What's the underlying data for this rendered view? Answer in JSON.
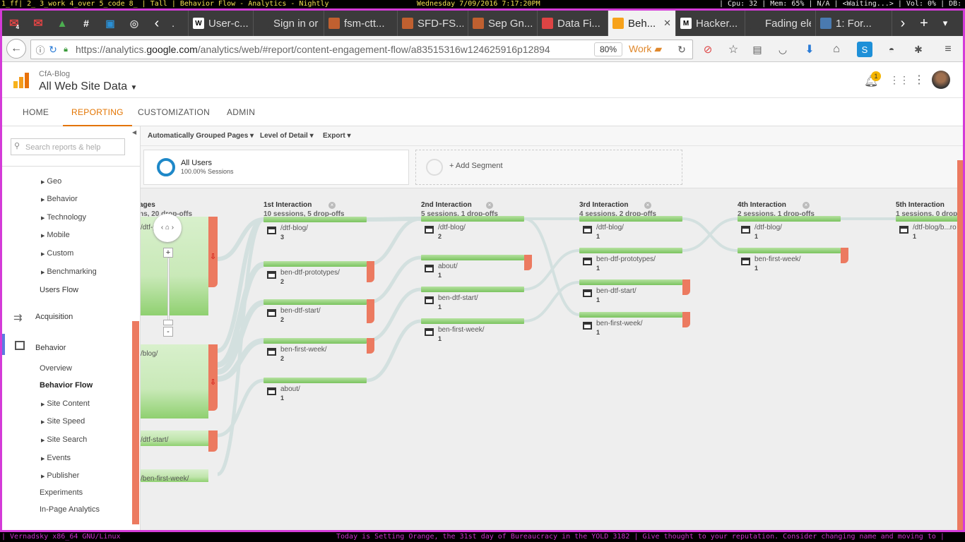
{
  "wm": {
    "top_left": "1_ff| 2_ 3_work 4_over 5_code 8_ | Tall | Behavior Flow - Analytics - Nightly",
    "top_center": "Wednesday  7/09/2016  7:17:20PM",
    "top_right": "| Cpu: 32 | Mem: 65% | N/A | <Waiting...> | Vol: 0% | DB:",
    "bottom_left": "| Vernadsky x86_64 GNU/Linux",
    "bottom_right": "Today is Setting Orange, the 31st day of Bureaucracy in the YOLD 3182  | Give thought to your reputation.  Consider changing name and moving to |"
  },
  "tabs": [
    {
      "label": "User-c...",
      "icon": "W",
      "color": "#ffffff"
    },
    {
      "label": "Sign in or ...",
      "icon": "",
      "color": "#3b3b3b"
    },
    {
      "label": "fsm-ctt...",
      "icon": "",
      "color": "#c06030"
    },
    {
      "label": "SFD-FS...",
      "icon": "",
      "color": "#c06030"
    },
    {
      "label": "Sep Gn...",
      "icon": "",
      "color": "#c06030"
    },
    {
      "label": "Data Fi...",
      "icon": "",
      "color": "#d44"
    },
    {
      "label": "Beh...",
      "icon": "",
      "color": "#f7a21b"
    },
    {
      "label": "Hacker...",
      "icon": "M",
      "color": "#ffffff"
    },
    {
      "label": "Fading ele...",
      "icon": "",
      "color": "#3b3b3b"
    },
    {
      "label": "1: For...",
      "icon": "",
      "color": "#4a7ab0"
    }
  ],
  "pinned_badge": "4",
  "nav": {
    "url_prefix": "https://analytics.",
    "url_domain": "google.com",
    "url_path": "/analytics/web/#report/content-engagement-flow/a83515316w124625916p12894",
    "zoom": "80%",
    "container": "Work"
  },
  "ga": {
    "account": "CfA-Blog",
    "property": "All Web Site Data",
    "notif_count": "1",
    "nav_items": [
      "HOME",
      "REPORTING",
      "CUSTOMIZATION",
      "ADMIN"
    ]
  },
  "sidebar": {
    "search_placeholder": "Search reports & help",
    "audience_items": [
      "Geo",
      "Behavior",
      "Technology",
      "Mobile",
      "Custom",
      "Benchmarking"
    ],
    "users_flow": "Users Flow",
    "acquisition": "Acquisition",
    "behavior": "Behavior",
    "behavior_items": [
      "Overview",
      "Behavior Flow",
      "Site Content",
      "Site Speed",
      "Site Search",
      "Events",
      "Publisher",
      "Experiments",
      "In-Page Analytics"
    ]
  },
  "toolbar": {
    "grouped": "Automatically Grouped Pages",
    "detail": "Level of Detail",
    "export": "Export"
  },
  "segments": {
    "all_users": "All Users",
    "all_users_sub": "100.00% Sessions",
    "add": "+ Add Segment"
  },
  "columns": [
    {
      "title": "ages",
      "sub": "ns, 20 drop-offs"
    },
    {
      "title": "1st Interaction",
      "sub": "10 sessions, 5 drop-offs"
    },
    {
      "title": "2nd Interaction",
      "sub": "5 sessions, 1 drop-offs"
    },
    {
      "title": "3rd Interaction",
      "sub": "4 sessions, 2 drop-offs"
    },
    {
      "title": "4th Interaction",
      "sub": "2 sessions, 1 drop-offs"
    },
    {
      "title": "5th Interaction",
      "sub": "1 sessions, 0 drop"
    }
  ],
  "landing": [
    {
      "label": "/dtf-pro...tes/"
    },
    {
      "label": "/blog/"
    },
    {
      "label": "/dtf-start/"
    },
    {
      "label": "/ben-first-week/"
    }
  ],
  "interactions": {
    "c1": [
      {
        "page": "/dtf-blog/",
        "count": "3"
      },
      {
        "page": "ben-dtf-prototypes/",
        "count": "2"
      },
      {
        "page": "ben-dtf-start/",
        "count": "2"
      },
      {
        "page": "ben-first-week/",
        "count": "2"
      },
      {
        "page": "about/",
        "count": "1"
      }
    ],
    "c2": [
      {
        "page": "/dtf-blog/",
        "count": "2"
      },
      {
        "page": "about/",
        "count": "1"
      },
      {
        "page": "ben-dtf-start/",
        "count": "1"
      },
      {
        "page": "ben-first-week/",
        "count": "1"
      }
    ],
    "c3": [
      {
        "page": "/dtf-blog/",
        "count": "1"
      },
      {
        "page": "ben-dtf-prototypes/",
        "count": "1"
      },
      {
        "page": "ben-dtf-start/",
        "count": "1"
      },
      {
        "page": "ben-first-week/",
        "count": "1"
      }
    ],
    "c4": [
      {
        "page": "/dtf-blog/",
        "count": "1"
      },
      {
        "page": "ben-first-week/",
        "count": "1"
      }
    ],
    "c5": [
      {
        "page": "/dtf-blog/b...ro",
        "count": "1"
      }
    ]
  }
}
